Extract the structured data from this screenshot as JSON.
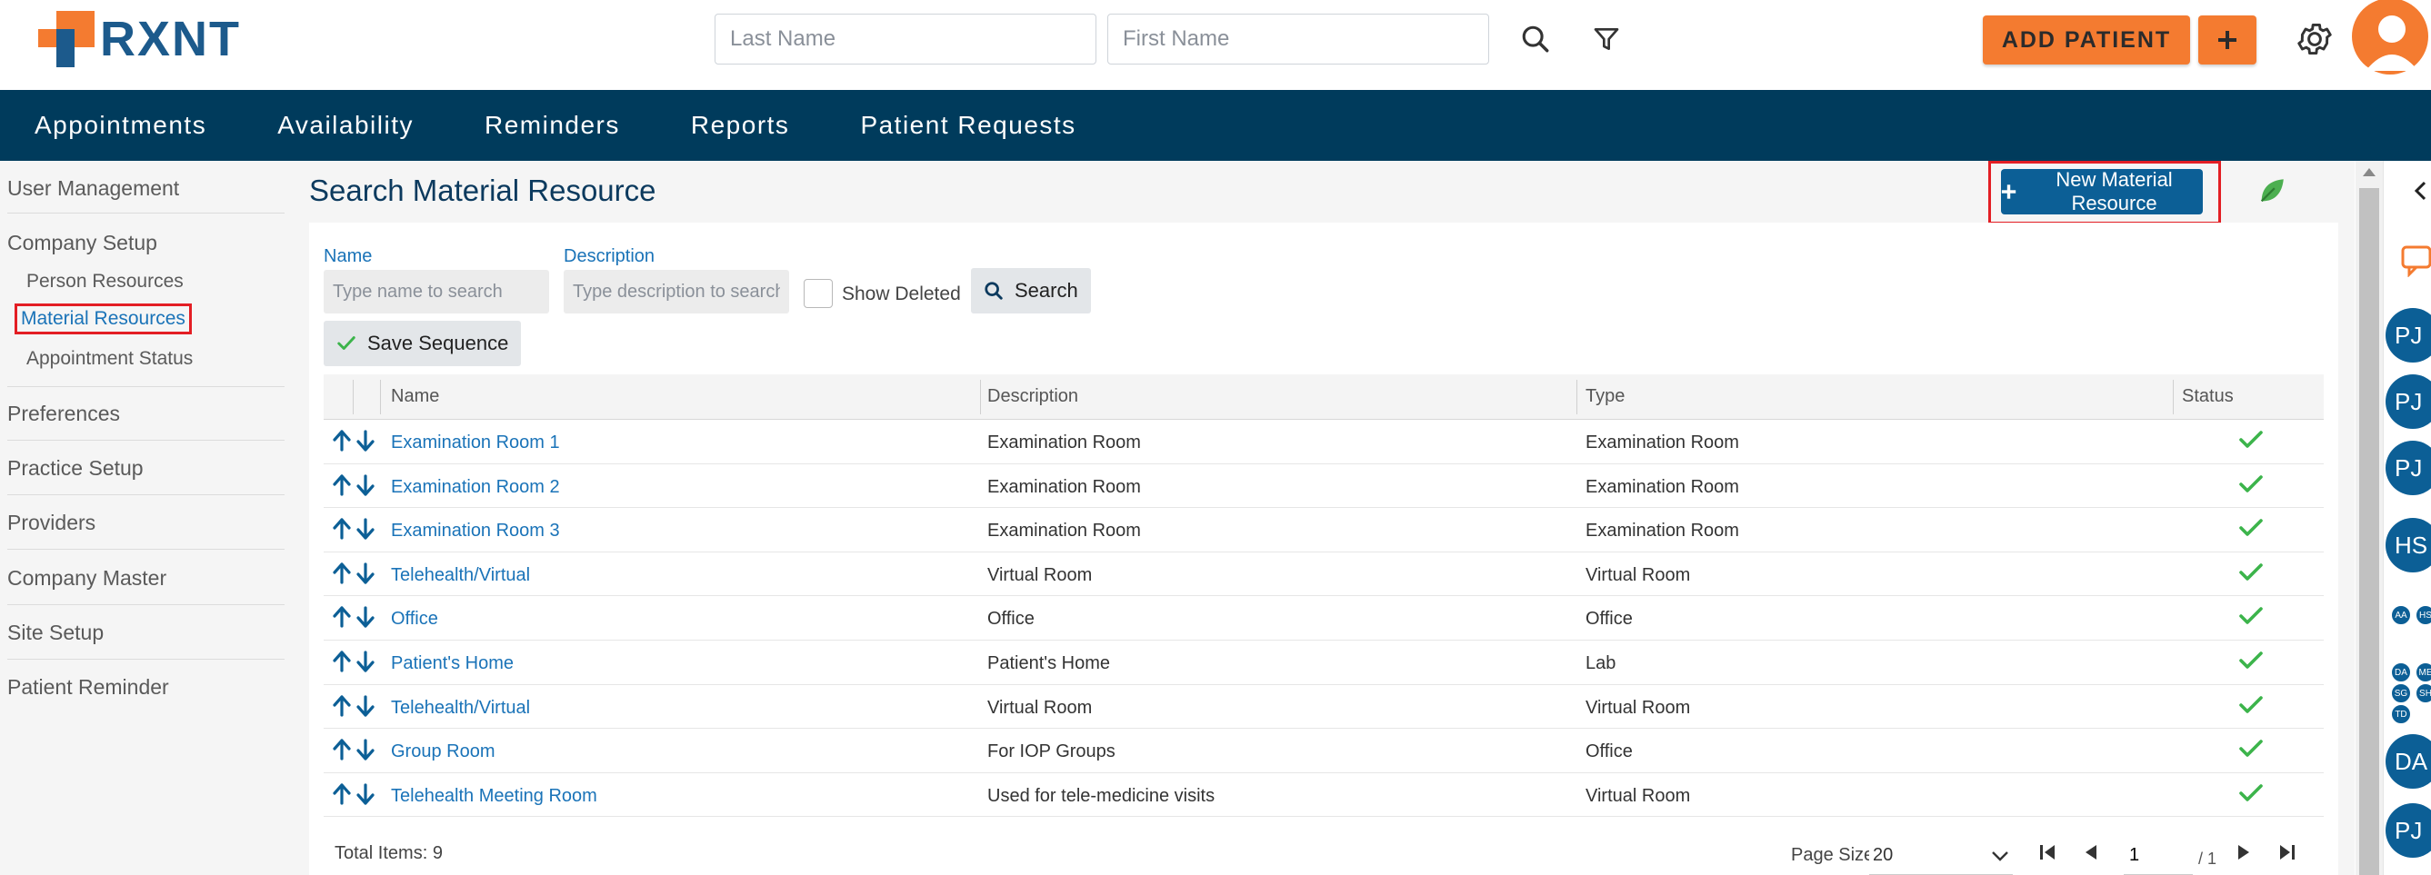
{
  "header": {
    "logo_text": "RXNT",
    "last_name_placeholder": "Last Name",
    "first_name_placeholder": "First Name",
    "add_patient_label": "ADD PATIENT",
    "add_plus_label": "+"
  },
  "nav": {
    "items": [
      "Appointments",
      "Availability",
      "Reminders",
      "Reports",
      "Patient Requests"
    ]
  },
  "sidebar": {
    "user_management": "User Management",
    "company_setup": "Company Setup",
    "person_resources": "Person Resources",
    "material_resources": "Material Resources",
    "appointment_status": "Appointment Status",
    "preferences": "Preferences",
    "practice_setup": "Practice Setup",
    "providers": "Providers",
    "company_master": "Company Master",
    "site_setup": "Site Setup",
    "patient_reminder": "Patient Reminder"
  },
  "main": {
    "title": "Search Material Resource",
    "new_button_label": "New Material Resource",
    "filters": {
      "name_label": "Name",
      "name_placeholder": "Type name to search",
      "description_label": "Description",
      "description_placeholder": "Type description to search",
      "show_deleted_label": "Show Deleted",
      "search_label": "Search",
      "save_sequence_label": "Save Sequence"
    },
    "table": {
      "columns": [
        "Name",
        "Description",
        "Type",
        "Status"
      ],
      "rows": [
        {
          "name": "Examination Room 1",
          "description": "Examination Room",
          "type": "Examination Room"
        },
        {
          "name": "Examination Room 2",
          "description": "Examination Room",
          "type": "Examination Room"
        },
        {
          "name": "Examination Room 3",
          "description": "Examination Room",
          "type": "Examination Room"
        },
        {
          "name": "Telehealth/Virtual",
          "description": "Virtual Room",
          "type": "Virtual Room"
        },
        {
          "name": "Office",
          "description": "Office",
          "type": "Office"
        },
        {
          "name": "Patient's Home",
          "description": "Patient's Home",
          "type": "Lab"
        },
        {
          "name": "Telehealth/Virtual",
          "description": "Virtual Room",
          "type": "Virtual Room"
        },
        {
          "name": "Group Room",
          "description": "For IOP Groups",
          "type": "Office"
        },
        {
          "name": "Telehealth Meeting Room",
          "description": "Used for tele-medicine visits",
          "type": "Virtual Room"
        }
      ]
    },
    "footer": {
      "total_items": "Total Items: 9",
      "page_size_label": "Page Size:",
      "page_size_value": "20",
      "page_value": "1",
      "page_total": "/ 1"
    }
  },
  "rail": {
    "avatars": [
      "PJ",
      "PJ",
      "PJ",
      "HS",
      "DA",
      "PJ"
    ],
    "small_avatars": [
      "AA",
      "HS",
      "DA",
      "ME",
      "SG",
      "SH",
      "TD"
    ]
  },
  "colors": {
    "brand_orange": "#f47b30",
    "brand_blue": "#1c5a8c",
    "nav_bg": "#003b5c",
    "primary_button": "#0c5f96",
    "link": "#1a73b8",
    "status_ok": "#3cb44b",
    "highlight_red": "#e31e24"
  },
  "icons": {
    "search": "search-icon",
    "filter": "filter-icon",
    "settings": "gear-icon",
    "status": "check-icon",
    "reorder_up": "arrow-up-icon",
    "reorder_down": "arrow-down-icon"
  }
}
